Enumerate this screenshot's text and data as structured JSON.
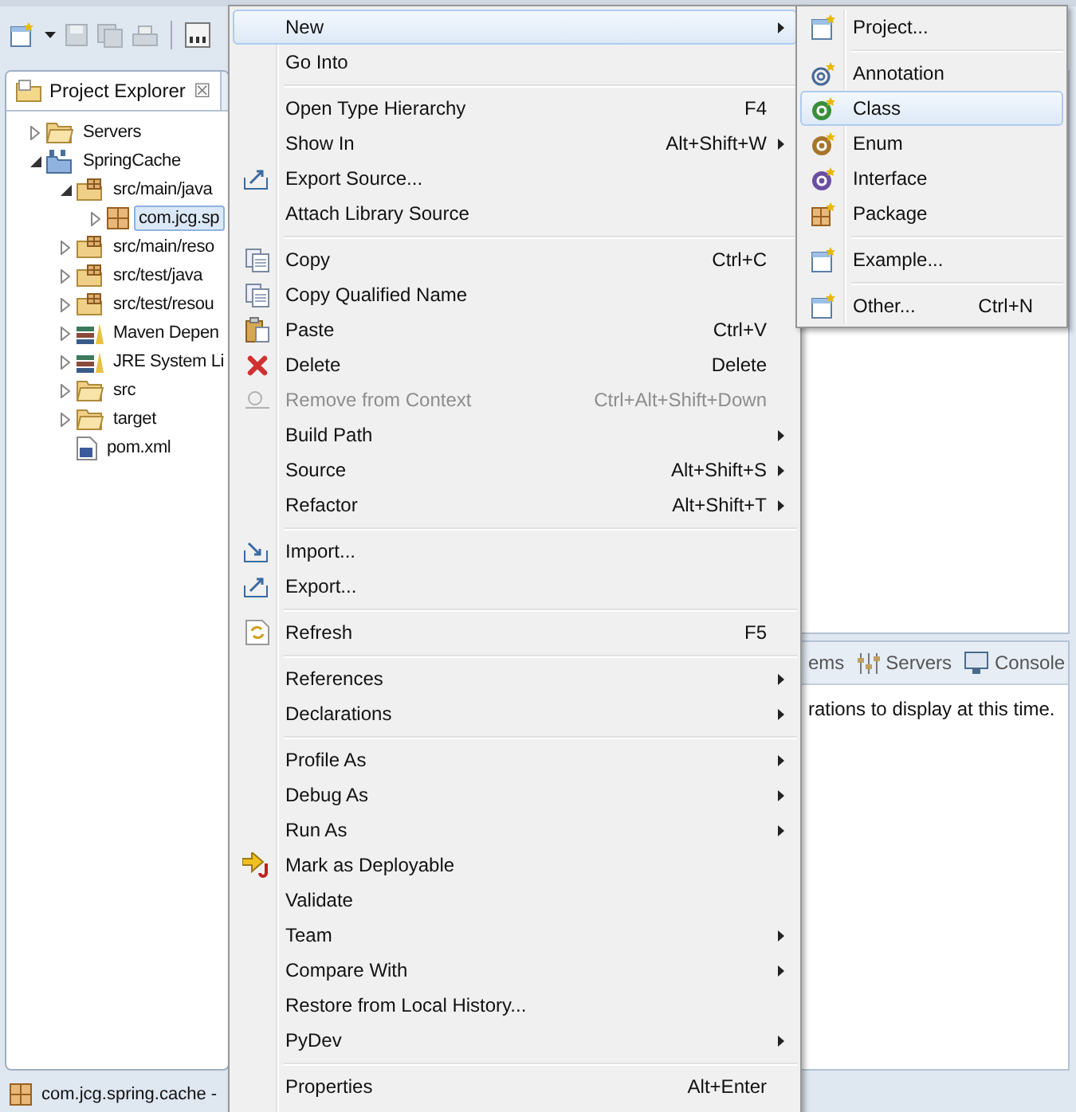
{
  "project_explorer": {
    "title": "Project Explorer",
    "close": "☒",
    "tree": [
      {
        "label": "Servers",
        "kind": "folder",
        "expanded": false,
        "selected": false
      },
      {
        "label": "SpringCache",
        "kind": "project",
        "expanded": true,
        "selected": false,
        "children": [
          {
            "label": "src/main/java",
            "kind": "source-folder",
            "expanded": true,
            "selected": false,
            "children": [
              {
                "label": "com.jcg.sp",
                "kind": "package",
                "expanded": false,
                "selected": true
              }
            ]
          },
          {
            "label": "src/main/reso",
            "kind": "source-folder",
            "expanded": false,
            "selected": false
          },
          {
            "label": "src/test/java",
            "kind": "source-folder",
            "expanded": false,
            "selected": false
          },
          {
            "label": "src/test/resou",
            "kind": "source-folder",
            "expanded": false,
            "selected": false
          },
          {
            "label": "Maven Depen",
            "kind": "library",
            "expanded": false,
            "selected": false
          },
          {
            "label": "JRE System Li",
            "kind": "library",
            "expanded": false,
            "selected": false
          },
          {
            "label": "src",
            "kind": "folder",
            "expanded": false,
            "selected": false
          },
          {
            "label": "target",
            "kind": "folder",
            "expanded": false,
            "selected": false
          },
          {
            "label": "pom.xml",
            "kind": "file",
            "selected": false
          }
        ]
      }
    ]
  },
  "bottom_panel": {
    "tabs": [
      {
        "label": "ems",
        "kind": "plain"
      },
      {
        "label": "Servers",
        "kind": "servers"
      },
      {
        "label": "Console",
        "kind": "console"
      }
    ],
    "message": "rations to display at this time."
  },
  "context_menu": {
    "groups": [
      [
        {
          "label": "New",
          "kind": "plain",
          "submenu": true,
          "disabled": false,
          "selected": true
        },
        {
          "label": "Go Into",
          "kind": "plain",
          "submenu": false,
          "disabled": false,
          "selected": false
        }
      ],
      [
        {
          "label": "Open Type Hierarchy",
          "shortcut": "F4",
          "kind": "plain",
          "submenu": false,
          "disabled": false,
          "selected": false
        },
        {
          "label": "Show In",
          "shortcut": "Alt+Shift+W",
          "kind": "plain",
          "submenu": true,
          "disabled": false,
          "selected": false
        },
        {
          "label": "Export Source...",
          "kind": "export",
          "submenu": false,
          "disabled": false,
          "selected": false
        },
        {
          "label": "Attach Library Source",
          "kind": "plain",
          "submenu": false,
          "disabled": false,
          "selected": false
        }
      ],
      [
        {
          "label": "Copy",
          "shortcut": "Ctrl+C",
          "kind": "copy",
          "submenu": false,
          "disabled": false,
          "selected": false
        },
        {
          "label": "Copy Qualified Name",
          "kind": "copy",
          "submenu": false,
          "disabled": false,
          "selected": false
        },
        {
          "label": "Paste",
          "shortcut": "Ctrl+V",
          "kind": "paste",
          "submenu": false,
          "disabled": false,
          "selected": false
        },
        {
          "label": "Delete",
          "shortcut": "Delete",
          "kind": "delete",
          "submenu": false,
          "disabled": false,
          "selected": false
        },
        {
          "label": "Remove from Context",
          "shortcut": "Ctrl+Alt+Shift+Down",
          "kind": "remove",
          "submenu": false,
          "disabled": true,
          "selected": false
        },
        {
          "label": "Build Path",
          "kind": "plain",
          "submenu": true,
          "disabled": false,
          "selected": false
        },
        {
          "label": "Source",
          "shortcut": "Alt+Shift+S",
          "kind": "plain",
          "submenu": true,
          "disabled": false,
          "selected": false
        },
        {
          "label": "Refactor",
          "shortcut": "Alt+Shift+T",
          "kind": "plain",
          "submenu": true,
          "disabled": false,
          "selected": false
        }
      ],
      [
        {
          "label": "Import...",
          "kind": "import",
          "submenu": false,
          "disabled": false,
          "selected": false
        },
        {
          "label": "Export...",
          "kind": "export",
          "submenu": false,
          "disabled": false,
          "selected": false
        }
      ],
      [
        {
          "label": "Refresh",
          "shortcut": "F5",
          "kind": "refresh",
          "submenu": false,
          "disabled": false,
          "selected": false
        }
      ],
      [
        {
          "label": "References",
          "kind": "plain",
          "submenu": true,
          "disabled": false,
          "selected": false
        },
        {
          "label": "Declarations",
          "kind": "plain",
          "submenu": true,
          "disabled": false,
          "selected": false
        }
      ],
      [
        {
          "label": "Profile As",
          "kind": "plain",
          "submenu": true,
          "disabled": false,
          "selected": false
        },
        {
          "label": "Debug As",
          "kind": "plain",
          "submenu": true,
          "disabled": false,
          "selected": false
        },
        {
          "label": "Run As",
          "kind": "plain",
          "submenu": true,
          "disabled": false,
          "selected": false
        },
        {
          "label": "Mark as Deployable",
          "kind": "deploy",
          "submenu": false,
          "disabled": false,
          "selected": false
        },
        {
          "label": "Validate",
          "kind": "plain",
          "submenu": false,
          "disabled": false,
          "selected": false
        },
        {
          "label": "Team",
          "kind": "plain",
          "submenu": true,
          "disabled": false,
          "selected": false
        },
        {
          "label": "Compare With",
          "kind": "plain",
          "submenu": true,
          "disabled": false,
          "selected": false
        },
        {
          "label": "Restore from Local History...",
          "kind": "plain",
          "submenu": false,
          "disabled": false,
          "selected": false
        },
        {
          "label": "PyDev",
          "kind": "plain",
          "submenu": true,
          "disabled": false,
          "selected": false
        }
      ],
      [
        {
          "label": "Properties",
          "shortcut": "Alt+Enter",
          "kind": "plain",
          "submenu": false,
          "disabled": false,
          "selected": false
        }
      ]
    ]
  },
  "new_submenu": {
    "groups": [
      [
        {
          "label": "Project...",
          "kind": "wizard",
          "selected": false
        }
      ],
      [
        {
          "label": "Annotation",
          "kind": "annotation",
          "selected": false
        },
        {
          "label": "Class",
          "kind": "class",
          "selected": true
        },
        {
          "label": "Enum",
          "kind": "enum",
          "selected": false
        },
        {
          "label": "Interface",
          "kind": "interface",
          "selected": false
        },
        {
          "label": "Package",
          "kind": "package",
          "selected": false
        }
      ],
      [
        {
          "label": "Example...",
          "kind": "wizard",
          "selected": false
        }
      ],
      [
        {
          "label": "Other...",
          "shortcut": "Ctrl+N",
          "kind": "wizard",
          "selected": false
        }
      ]
    ]
  },
  "status_bar": {
    "text": "com.jcg.spring.cache -"
  }
}
